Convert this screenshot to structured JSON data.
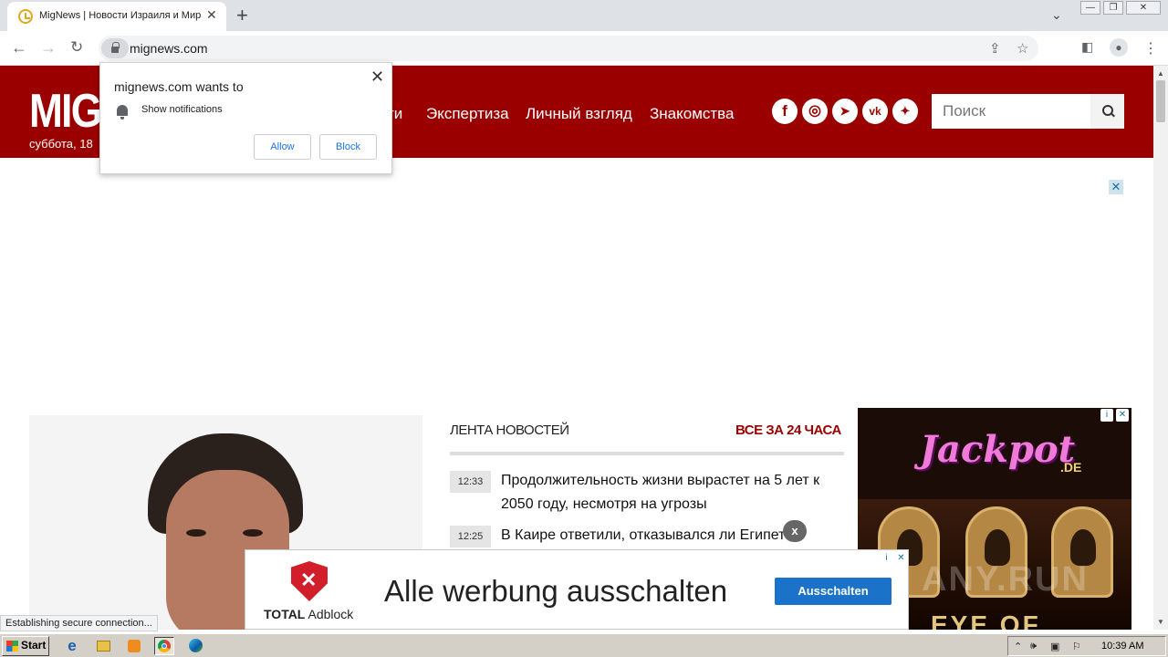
{
  "browser": {
    "tab_title": "MigNews | Новости Израиля и Мира",
    "tab_close": "✕",
    "new_tab": "+",
    "url": "mignews.com",
    "window_controls": [
      "—",
      "❐",
      "✕"
    ]
  },
  "notification": {
    "title": "mignews.com wants to",
    "permission": "Show notifications",
    "allow_label": "Allow",
    "block_label": "Block",
    "close": "✕"
  },
  "site": {
    "logo": "MIG",
    "date": "суббота, 18",
    "nav": [
      "ти",
      "Экспертиза",
      "Личный взгляд",
      "Знакомства"
    ],
    "social": [
      {
        "name": "facebook-icon",
        "glyph": "f"
      },
      {
        "name": "instagram-icon",
        "glyph": "◎"
      },
      {
        "name": "telegram-icon",
        "glyph": "➤"
      },
      {
        "name": "vk-icon",
        "glyph": "vk"
      },
      {
        "name": "twitter-icon",
        "glyph": "✦"
      }
    ],
    "search_placeholder": "Поиск",
    "accent": "#9b0000"
  },
  "ad_close": "✕",
  "feed": {
    "title": "ЛЕНТА НОВОСТЕЙ",
    "all_link": "ВСЕ ЗА 24 ЧАСА",
    "items": [
      {
        "time": "12:33",
        "text": "Продолжительность жизни вырастет на 5 лет к 2050 году, несмотря на угрозы"
      },
      {
        "time": "12:25",
        "text": "В Каире ответили, отказывался ли Египет"
      }
    ]
  },
  "side_ad": {
    "brand": "Jackpot",
    "brand_suffix": ".DE",
    "bottom_text": "EYE OF",
    "info_icon": "i",
    "close_icon": "✕"
  },
  "banner": {
    "close": "x",
    "brand_bold": "TOTAL",
    "brand_rest": " Adblock",
    "headline": "Alle werbung ausschalten",
    "cta": "Ausschalten",
    "info_icon": "i",
    "close_icon": "✕"
  },
  "status": "Establishing secure connection...",
  "watermark": "ANY.RUN",
  "taskbar": {
    "start": "Start",
    "clock": "10:39 AM"
  }
}
